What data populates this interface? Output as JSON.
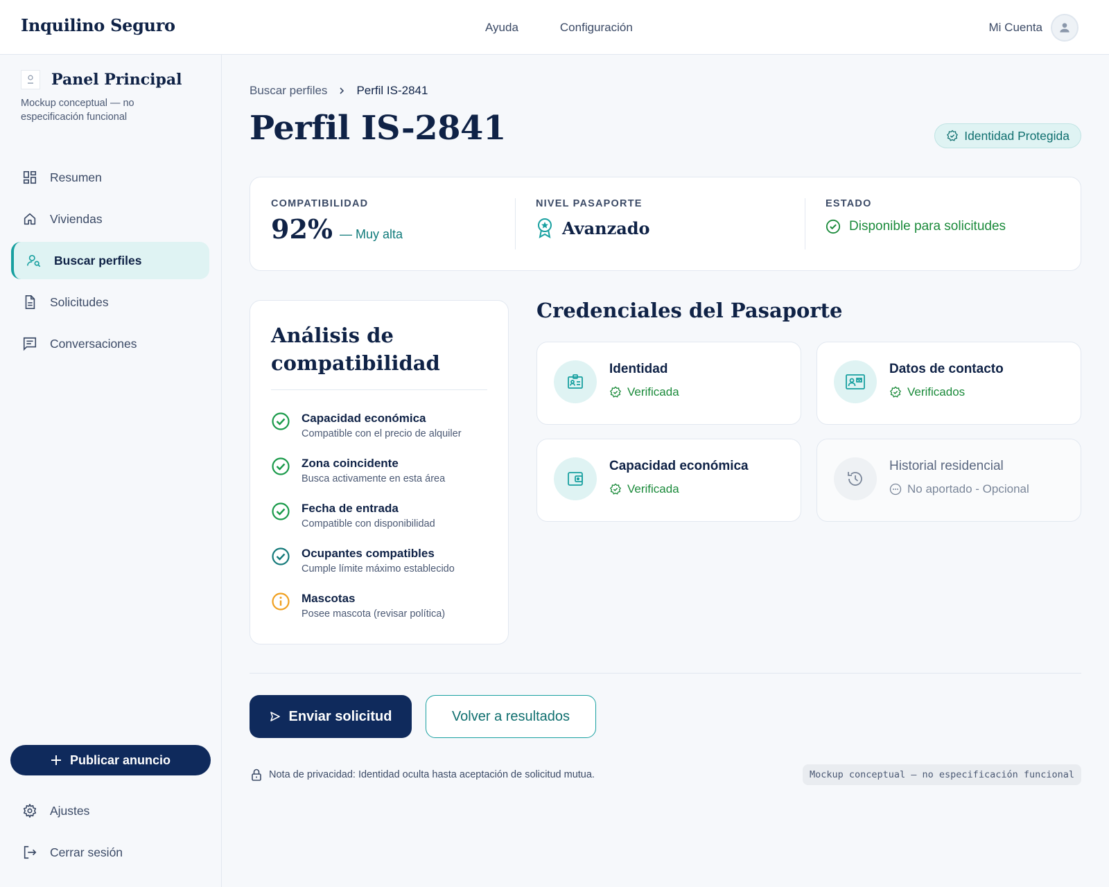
{
  "header": {
    "brand": "Inquilino Seguro",
    "nav": [
      "Ayuda",
      "Configuración"
    ],
    "account_label": "Mi Cuenta"
  },
  "sidebar": {
    "title": "Panel Principal",
    "subtitle": "Mockup conceptual — no especificación funcional",
    "items": [
      {
        "label": "Resumen",
        "icon": "dashboard-icon"
      },
      {
        "label": "Viviendas",
        "icon": "home-icon"
      },
      {
        "label": "Buscar perfiles",
        "icon": "person-search-icon",
        "active": true
      },
      {
        "label": "Solicitudes",
        "icon": "document-icon"
      },
      {
        "label": "Conversaciones",
        "icon": "chat-icon"
      }
    ],
    "publish_label": "Publicar anuncio",
    "bottom_items": [
      {
        "label": "Ajustes",
        "icon": "gear-icon"
      },
      {
        "label": "Cerrar sesión",
        "icon": "logout-icon"
      }
    ]
  },
  "breadcrumb": {
    "parent": "Buscar perfiles",
    "current": "Perfil IS-2841"
  },
  "page": {
    "title": "Perfil IS-2841",
    "badge": "Identidad Protegida"
  },
  "stats": {
    "compat_label": "COMPATIBILIDAD",
    "compat_value": "92%",
    "compat_note": "— Muy alta",
    "level_label": "NIVEL PASAPORTE",
    "level_value": "Avanzado",
    "status_label": "ESTADO",
    "status_value": "Disponible para solicitudes"
  },
  "analysis": {
    "title": "Análisis de compatibilidad",
    "criteria": [
      {
        "name": "Capacidad económica",
        "desc": "Compatible con el precio de alquiler",
        "status": "ok"
      },
      {
        "name": "Zona coincidente",
        "desc": "Busca activamente en esta área",
        "status": "ok"
      },
      {
        "name": "Fecha de entrada",
        "desc": "Compatible con disponibilidad",
        "status": "ok"
      },
      {
        "name": "Ocupantes compatibles",
        "desc": "Cumple límite máximo establecido",
        "status": "ok-teal"
      },
      {
        "name": "Mascotas",
        "desc": "Posee mascota (revisar política)",
        "status": "warning"
      }
    ]
  },
  "credentials": {
    "title": "Credenciales del Pasaporte",
    "items": [
      {
        "name": "Identidad",
        "status": "Verificada",
        "icon": "id-badge-icon"
      },
      {
        "name": "Datos de contacto",
        "status": "Verificados",
        "icon": "contact-card-icon"
      },
      {
        "name": "Capacidad económica",
        "status": "Verificada",
        "icon": "wallet-icon"
      },
      {
        "name": "Historial residencial",
        "status": "No aportado - Opcional",
        "icon": "history-icon"
      }
    ]
  },
  "actions": {
    "primary": "Enviar solicitud",
    "secondary": "Volver a resultados"
  },
  "footer": {
    "privacy": "Nota de privacidad: Identidad oculta hasta aceptación de solicitud mutua.",
    "tag": "Mockup conceptual — no especificación funcional"
  },
  "colors": {
    "navy": "#0f2a5c",
    "teal": "#18a0a0",
    "green": "#1a8a3a",
    "amber": "#f0a020"
  }
}
